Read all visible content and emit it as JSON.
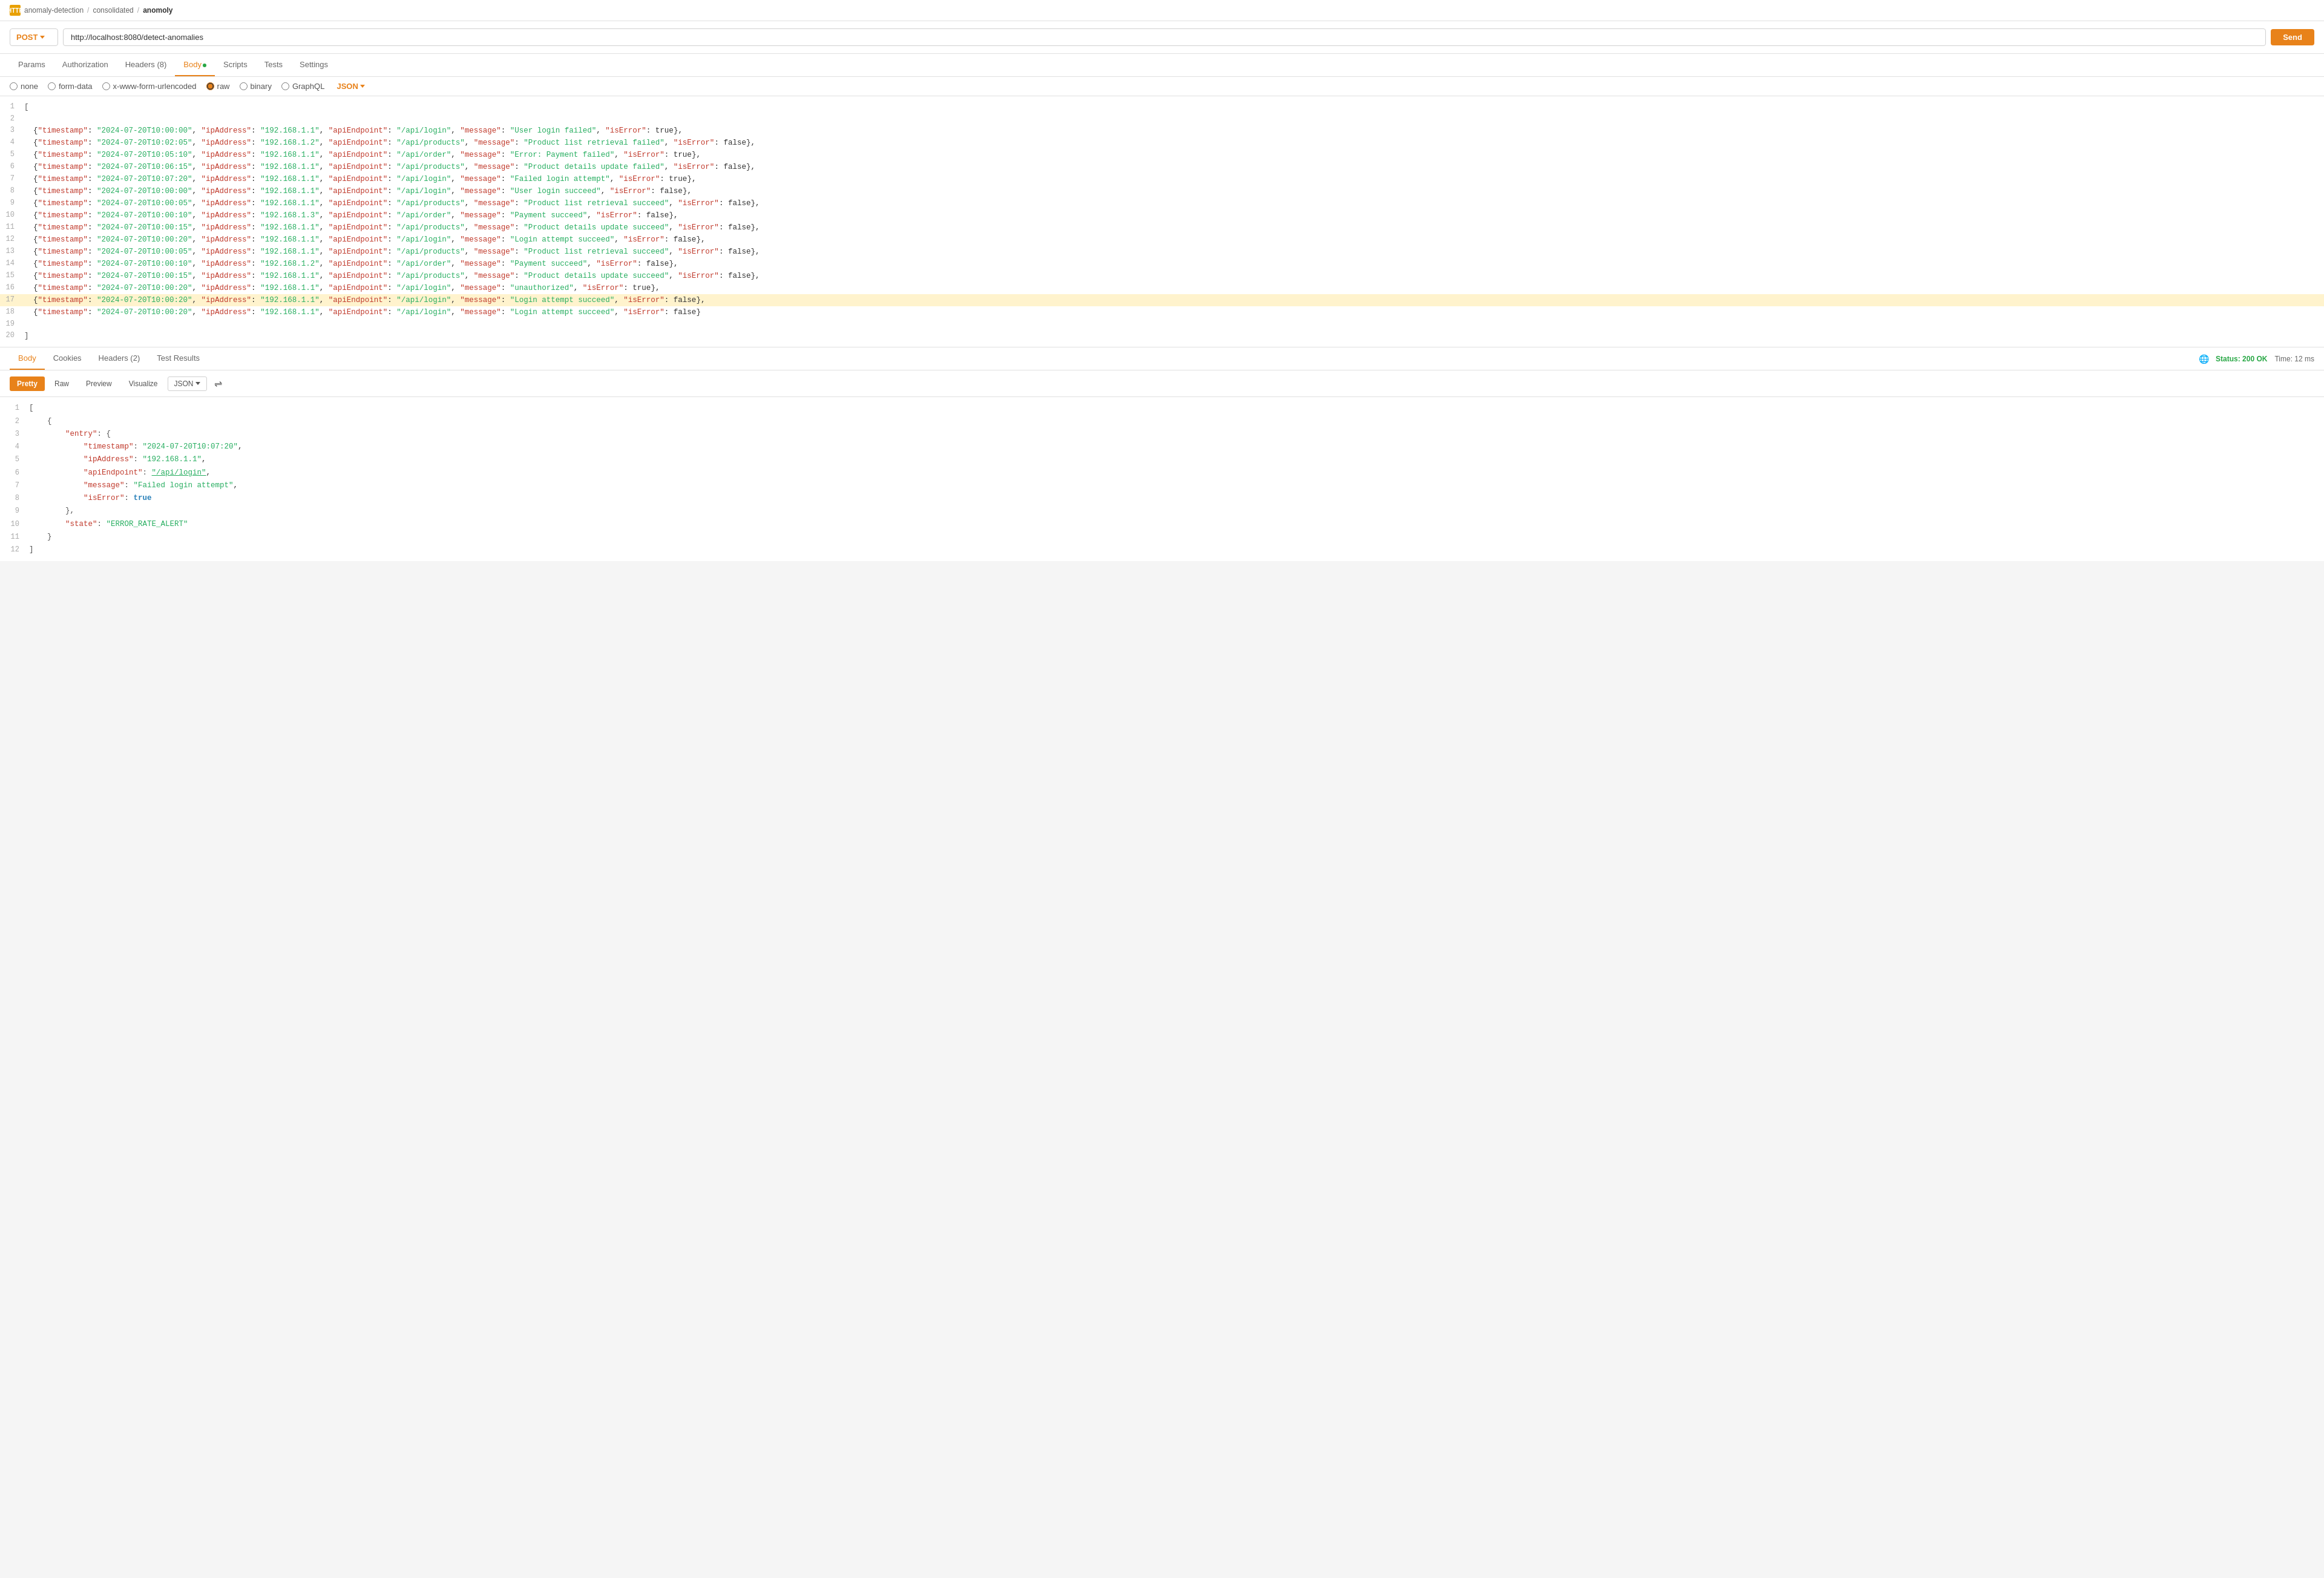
{
  "breadcrumb": {
    "icon": "HTTP",
    "path": [
      "anomaly-detection",
      "consolidated",
      "anomoly"
    ]
  },
  "request": {
    "method": "POST",
    "url": "http://localhost:8080/detect-anomalies",
    "send_label": "Send"
  },
  "tabs": [
    {
      "label": "Params",
      "active": false
    },
    {
      "label": "Authorization",
      "active": false
    },
    {
      "label": "Headers (8)",
      "active": false
    },
    {
      "label": "Body",
      "active": true,
      "dot": true
    },
    {
      "label": "Scripts",
      "active": false
    },
    {
      "label": "Tests",
      "active": false
    },
    {
      "label": "Settings",
      "active": false
    }
  ],
  "body_types": [
    "none",
    "form-data",
    "x-www-form-urlencoded",
    "raw",
    "binary",
    "GraphQL"
  ],
  "body_selected": "raw",
  "body_format": "JSON",
  "code_lines": [
    {
      "num": 1,
      "content": "["
    },
    {
      "num": 2,
      "content": ""
    },
    {
      "num": 3,
      "content": "  {\"timestamp\": \"2024-07-20T10:00:00\", \"ipAddress\": \"192.168.1.1\", \"apiEndpoint\": \"/api/login\", \"message\": \"User login failed\", \"isError\": true},"
    },
    {
      "num": 4,
      "content": "  {\"timestamp\": \"2024-07-20T10:02:05\", \"ipAddress\": \"192.168.1.2\", \"apiEndpoint\": \"/api/products\", \"message\": \"Product list retrieval failed\", \"isError\": false},"
    },
    {
      "num": 5,
      "content": "  {\"timestamp\": \"2024-07-20T10:05:10\", \"ipAddress\": \"192.168.1.1\", \"apiEndpoint\": \"/api/order\", \"message\": \"Error: Payment failed\", \"isError\": true},"
    },
    {
      "num": 6,
      "content": "  {\"timestamp\": \"2024-07-20T10:06:15\", \"ipAddress\": \"192.168.1.1\", \"apiEndpoint\": \"/api/products\", \"message\": \"Product details update failed\", \"isError\": false},"
    },
    {
      "num": 7,
      "content": "  {\"timestamp\": \"2024-07-20T10:07:20\", \"ipAddress\": \"192.168.1.1\", \"apiEndpoint\": \"/api/login\", \"message\": \"Failed login attempt\", \"isError\": true},"
    },
    {
      "num": 8,
      "content": "  {\"timestamp\": \"2024-07-20T10:00:00\", \"ipAddress\": \"192.168.1.1\", \"apiEndpoint\": \"/api/login\", \"message\": \"User login succeed\", \"isError\": false},"
    },
    {
      "num": 9,
      "content": "  {\"timestamp\": \"2024-07-20T10:00:05\", \"ipAddress\": \"192.168.1.1\", \"apiEndpoint\": \"/api/products\", \"message\": \"Product list retrieval succeed\", \"isError\": false},"
    },
    {
      "num": 10,
      "content": "  {\"timestamp\": \"2024-07-20T10:00:10\", \"ipAddress\": \"192.168.1.3\", \"apiEndpoint\": \"/api/order\", \"message\": \"Payment succeed\", \"isError\": false},"
    },
    {
      "num": 11,
      "content": "  {\"timestamp\": \"2024-07-20T10:00:15\", \"ipAddress\": \"192.168.1.1\", \"apiEndpoint\": \"/api/products\", \"message\": \"Product details update succeed\", \"isError\": false},"
    },
    {
      "num": 12,
      "content": "  {\"timestamp\": \"2024-07-20T10:00:20\", \"ipAddress\": \"192.168.1.1\", \"apiEndpoint\": \"/api/login\", \"message\": \"Login attempt succeed\", \"isError\": false},"
    },
    {
      "num": 13,
      "content": "  {\"timestamp\": \"2024-07-20T10:00:05\", \"ipAddress\": \"192.168.1.1\", \"apiEndpoint\": \"/api/products\", \"message\": \"Product list retrieval succeed\", \"isError\": false},"
    },
    {
      "num": 14,
      "content": "  {\"timestamp\": \"2024-07-20T10:00:10\", \"ipAddress\": \"192.168.1.2\", \"apiEndpoint\": \"/api/order\", \"message\": \"Payment succeed\", \"isError\": false},"
    },
    {
      "num": 15,
      "content": "  {\"timestamp\": \"2024-07-20T10:00:15\", \"ipAddress\": \"192.168.1.1\", \"apiEndpoint\": \"/api/products\", \"message\": \"Product details update succeed\", \"isError\": false},"
    },
    {
      "num": 16,
      "content": "  {\"timestamp\": \"2024-07-20T10:00:20\", \"ipAddress\": \"192.168.1.1\", \"apiEndpoint\": \"/api/login\", \"message\": \"unauthorized\", \"isError\": true},"
    },
    {
      "num": 17,
      "content": "  {\"timestamp\": \"2024-07-20T10:00:20\", \"ipAddress\": \"192.168.1.1\", \"apiEndpoint\": \"/api/login\", \"message\": \"Login attempt succeed\", \"isError\": false},",
      "highlight": true
    },
    {
      "num": 18,
      "content": "  {\"timestamp\": \"2024-07-20T10:00:20\", \"ipAddress\": \"192.168.1.1\", \"apiEndpoint\": \"/api/login\", \"message\": \"Login attempt succeed\", \"isError\": false}"
    },
    {
      "num": 19,
      "content": ""
    },
    {
      "num": 20,
      "content": "]"
    }
  ],
  "response": {
    "tabs": [
      "Body",
      "Cookies",
      "Headers (2)",
      "Test Results"
    ],
    "active_tab": "Body",
    "status": "Status: 200 OK",
    "time": "Time: 12 ms",
    "format_tabs": [
      "Pretty",
      "Raw",
      "Preview",
      "Visualize"
    ],
    "active_format": "Pretty",
    "format_type": "JSON",
    "lines": [
      {
        "num": 1,
        "content": "["
      },
      {
        "num": 2,
        "content": "    {"
      },
      {
        "num": 3,
        "content": "        \"entry\": {",
        "type": "key"
      },
      {
        "num": 4,
        "content": "            \"timestamp\": \"2024-07-20T10:07:20\",",
        "type": "key-str"
      },
      {
        "num": 5,
        "content": "            \"ipAddress\": \"192.168.1.1\",",
        "type": "key-str"
      },
      {
        "num": 6,
        "content": "            \"apiEndpoint\": \"/api/login\",",
        "type": "key-link"
      },
      {
        "num": 7,
        "content": "            \"message\": \"Failed login attempt\",",
        "type": "key-str"
      },
      {
        "num": 8,
        "content": "            \"isError\": true",
        "type": "key-bool"
      },
      {
        "num": 9,
        "content": "        },"
      },
      {
        "num": 10,
        "content": "        \"state\": \"ERROR_RATE_ALERT\"",
        "type": "key-str"
      },
      {
        "num": 11,
        "content": "    }"
      },
      {
        "num": 12,
        "content": "]"
      }
    ]
  }
}
